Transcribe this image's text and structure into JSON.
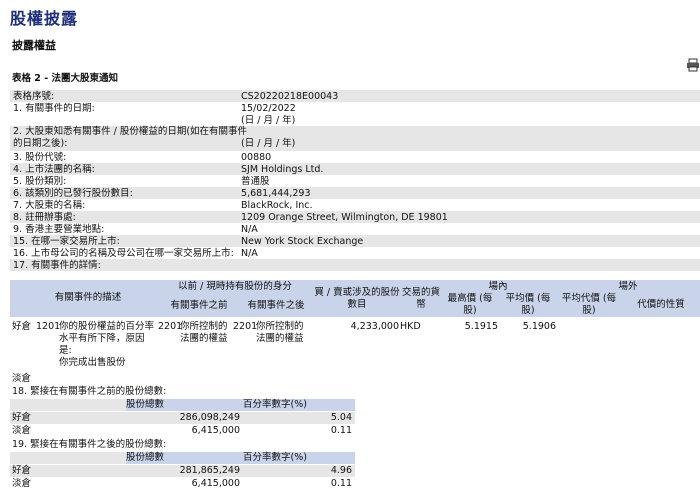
{
  "header": {
    "title": "股權披露",
    "subtitle": "披露權益",
    "table_title": "表格 2 - 法團大股東通知"
  },
  "info_rows": [
    {
      "label": "表格序號:",
      "value": "CS20220218E00043"
    },
    {
      "label": "1. 有關事件的日期:",
      "value": "15/02/2022"
    },
    {
      "label": "",
      "value": "(日 / 月 / 年)"
    },
    {
      "label": "2. 大股東知悉有關事件 / 股份權益的日期(如在有關事件",
      "value": ""
    },
    {
      "label": "的日期之後):",
      "value": "(日 / 月 / 年)"
    },
    {
      "label": "3. 股份代號:",
      "value": "00880"
    },
    {
      "label": "4. 上市法團的名稱:",
      "value": "SJM Holdings Ltd."
    },
    {
      "label": "5. 股份類別:",
      "value": "普通股"
    },
    {
      "label": "6. 該類別的已發行股份數目:",
      "value": "5,681,444,293"
    },
    {
      "label": "7. 大股東的名稱:",
      "value": "BlackRock, Inc."
    },
    {
      "label": "8. 註冊辦事處:",
      "value": "1209 Orange Street, Wilmington, DE 19801"
    },
    {
      "label": "9. 香港主要營業地點:",
      "value": "N/A"
    },
    {
      "label": "15. 在哪一家交易所上市:",
      "value": "New York Stock Exchange"
    },
    {
      "label": "16. 上市母公司的名稱及母公司在哪一家交易所上市:",
      "value": "N/A"
    },
    {
      "label": "17. 有關事件的詳情:",
      "value": ""
    }
  ],
  "details_header": {
    "event_desc": "有關事件的描述",
    "capacity": "以前 / 現時持有股份的身分",
    "before": "有關事件之前",
    "after": "有關事件之後",
    "shares": "買 / 賣或涉及的股份",
    "shares2": "數目",
    "currency": "交易的貨",
    "currency2": "幣",
    "onexch": "場內",
    "offexch": "場外",
    "highest": "最高價 (每",
    "highest2": "股)",
    "average": "平均價 (每",
    "average2": "股)",
    "avg_off": "平均代價 (每",
    "avg_off2": "股)",
    "consideration": "代價的性質"
  },
  "details_row": {
    "position": "好倉",
    "code": "1201",
    "desc_lines": [
      "你的股份權益的百分率",
      "水平有所下降，原因",
      "是:",
      "你完成出售股份"
    ],
    "before_code": "2201",
    "before_lines": [
      "你所控制的",
      "法團的權益"
    ],
    "after_code": "2201",
    "after_lines": [
      "你所控制的",
      "法團的權益"
    ],
    "shares": "4,233,000",
    "currency": "HKD",
    "highest": "5.1915",
    "average": "5.1906"
  },
  "short_label": "淡倉",
  "section18": {
    "title": "18. 緊接在有關事件之前的股份總數:",
    "col_shares": "股份總數",
    "col_pct": "百分率數字(%)",
    "rows": [
      {
        "pos": "好倉",
        "shares": "286,098,249",
        "pct": "5.04"
      },
      {
        "pos": "淡倉",
        "shares": "6,415,000",
        "pct": "0.11"
      }
    ]
  },
  "section19": {
    "title": "19. 緊接在有關事件之後的股份總數:",
    "col_shares": "股份總數",
    "col_pct": "百分率數字(%)",
    "rows": [
      {
        "pos": "好倉",
        "shares": "281,865,249",
        "pct": "4.96"
      },
      {
        "pos": "淡倉",
        "shares": "6,415,000",
        "pct": "0.11"
      }
    ]
  },
  "colors": {
    "title": "#1f2f7a",
    "header_blue": "#c9d3ea",
    "row_grey": "#e6e6e6"
  },
  "icons": [
    "print-icon"
  ]
}
